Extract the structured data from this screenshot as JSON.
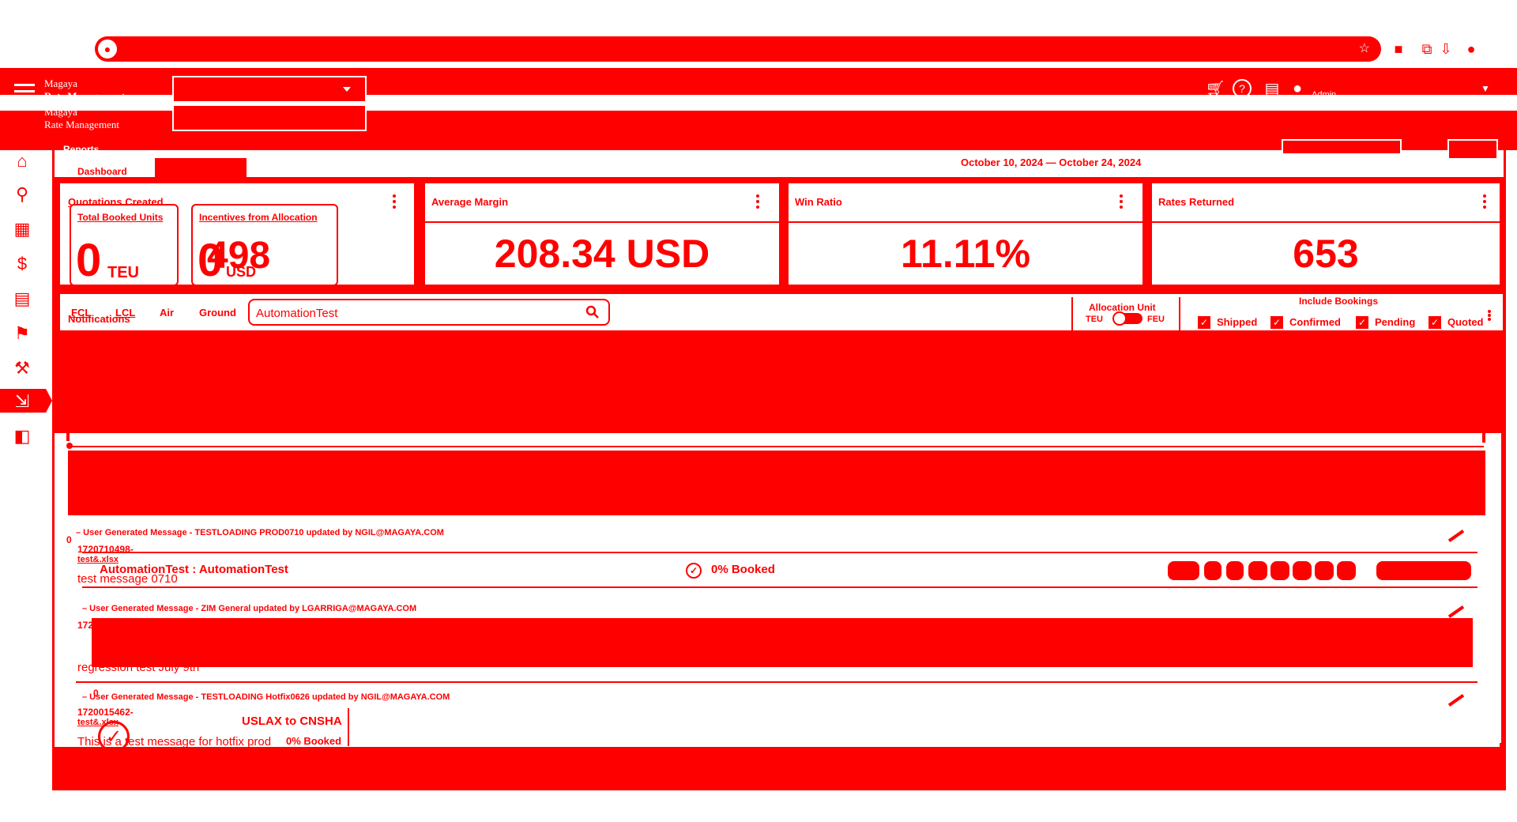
{
  "browser": {
    "logo_glyph": "●",
    "star_glyph": "☆"
  },
  "header": {
    "brand_line1": "Magaya",
    "brand_line2": "Rate Management",
    "brand_line3": "Magaya",
    "brand_line4": "Rate Management",
    "user_name": "Admin"
  },
  "page": {
    "section": "Reports",
    "tab_dashboard": "Dashboard",
    "date_range": "October 10, 2024 — October 24, 2024"
  },
  "kpis": {
    "quotations": {
      "title": "Quotations Created",
      "total_booked_title": "Total Booked Units",
      "total_booked_value": "0",
      "total_booked_unit": "TEU",
      "incentives_title": "Incentives from Allocation",
      "incentives_value_a": "498",
      "incentives_value_b": "0",
      "incentives_unit": "USD"
    },
    "average_margin": {
      "title": "Average Margin",
      "value": "208.34 USD"
    },
    "win_ratio": {
      "title": "Win Ratio",
      "value": "11.11%"
    },
    "rates_returned": {
      "title": "Rates Returned",
      "value": "653"
    }
  },
  "filters": {
    "modes": [
      "FCL",
      "LCL",
      "Air",
      "Ground"
    ],
    "notifications_label": "Notifications",
    "search_value": "AutomationTest",
    "allocation_unit_label": "Allocation Unit",
    "alloc_opt_teu": "TEU",
    "alloc_opt_feu": "FEU",
    "include_bookings_label": "Include Bookings",
    "checks": [
      "Shipped",
      "Confirmed",
      "Pending",
      "Quoted"
    ]
  },
  "notifications": [
    {
      "head": "– User Generated Message - TESTLOADING PROD0710 updated by NGIL@MAGAYA.COM",
      "count": "0",
      "id": "1720710498-",
      "file": "test&.xlsx",
      "msg": "test message 0710"
    },
    {
      "head": "– User Generated Message - ZIM General updated by LGARRIGA@MAGAYA.COM",
      "count": "",
      "id": "172",
      "file": "",
      "msg": "regression test July 9th"
    },
    {
      "head": "– User Generated Message - TESTLOADING Hotfix0626 updated by NGIL@MAGAYA.COM",
      "count": "0",
      "id": "1720015462-",
      "file": "test&.xlsx",
      "msg": "This is a test message for hotfix prod"
    }
  ],
  "result_row": {
    "title": "AutomationTest : AutomationTest",
    "booked": "0% Booked",
    "check_glyph": "✓"
  },
  "route_row": {
    "title": "USLAX to CNSHA",
    "booked": "0% Booked",
    "check_glyph": "✓"
  },
  "colors": {
    "primary": "#ff0000",
    "background": "#ffffff"
  }
}
